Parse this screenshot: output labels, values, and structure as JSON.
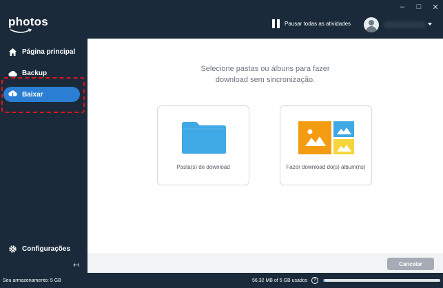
{
  "app": {
    "logo_text": "photos"
  },
  "window_controls": {
    "minimize": "–",
    "maximize": "□",
    "close": "✕"
  },
  "header": {
    "pause_label": "Pausar todas as atividades",
    "user_caret": "▾"
  },
  "sidebar": {
    "items": [
      {
        "label": "Página principal",
        "icon": "home-icon"
      },
      {
        "label": "Backup",
        "icon": "cloud-icon"
      },
      {
        "label": "Baixar",
        "icon": "cloud-download-icon",
        "active": true
      },
      {
        "label": "Configurações",
        "icon": "gear-icon"
      }
    ],
    "collapse_glyph": "↤"
  },
  "main": {
    "instruction_line1": "Selecione pastas ou álbuns para fazer",
    "instruction_line2": "download sem sincronização.",
    "cards": [
      {
        "label": "Pasta(s) de download",
        "icon": "folder-icon"
      },
      {
        "label": "Fazer download do(s) álbum(ns)",
        "icon": "album-icon"
      }
    ]
  },
  "actions": {
    "cancel_label": "Cancelar"
  },
  "status": {
    "storage_label": "Seu armazenamento: 5 GB",
    "usage_label": "56,32 MB of 5 GB usados",
    "help_glyph": "?",
    "usage_fraction": 0.011
  },
  "colors": {
    "accent": "#2a7fd4",
    "dark_bg": "#1a2a3a",
    "highlight_dashed": "#e0131c",
    "folder_blue": "#3fa9e6",
    "album_orange": "#f39c12",
    "album_yellow": "#f7d43b"
  }
}
